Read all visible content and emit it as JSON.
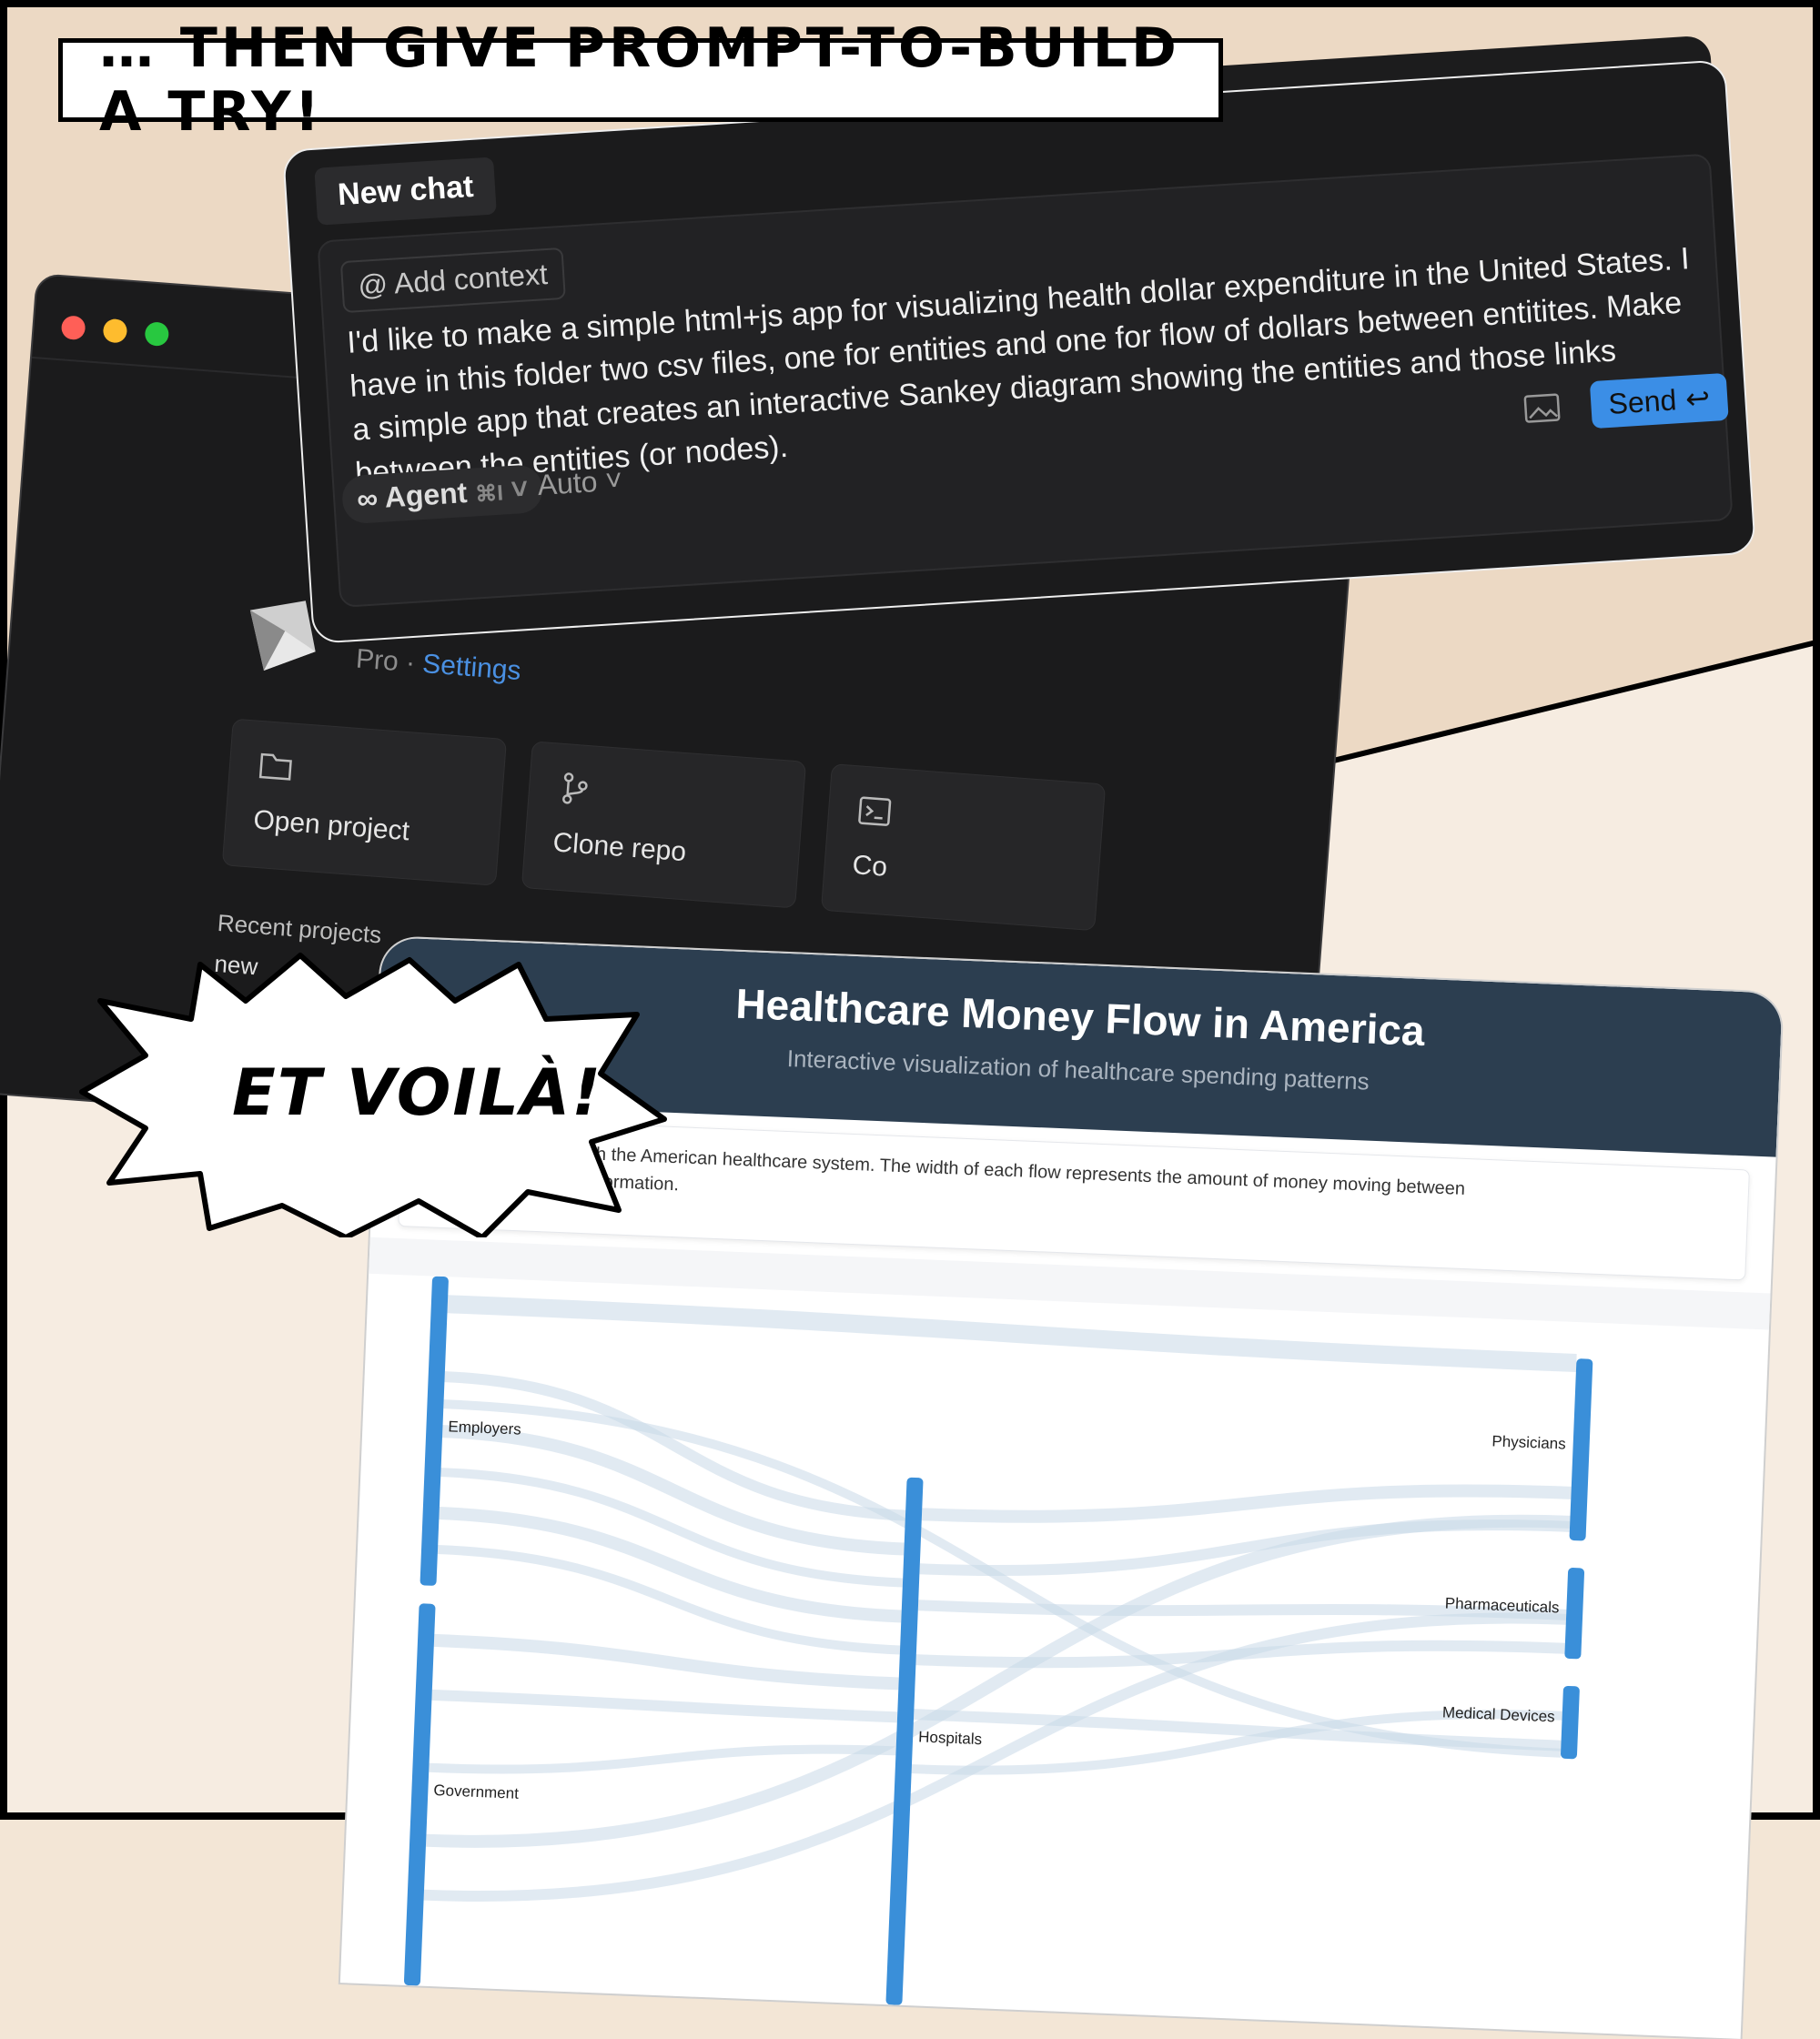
{
  "caption": "… THEN GIVE PROMPT-TO-BUILD A TRY!",
  "burst": "ET VOILÀ!",
  "chat": {
    "tab": "New chat",
    "add_context": "Add context",
    "prompt": "I'd like to make a simple html+js app for visualizing health dollar expenditure in the United States. I have in this folder two csv files, one for entities and one for flow of dollars between entitites. Make a simple app that creates an interactive Sankey diagram showing the entities and those links between the entities (or nodes).",
    "send": "Send",
    "agent": "Agent",
    "agent_shortcut": "⌘I",
    "auto": "Auto"
  },
  "home": {
    "plan": "Pro",
    "settings": "Settings",
    "open_project": "Open project",
    "clone_repo": "Clone repo",
    "third_card": "Co",
    "recent_projects": "Recent projects",
    "recent_item": "new"
  },
  "app": {
    "title": "Healthcare Money Flow in America",
    "subtitle": "Interactive visualization of healthcare spending patterns",
    "info_line1": "w money flows through the American healthcare system. The width of each flow represents the amount of money moving between",
    "info_line2": "lows to see detailed information."
  },
  "chart_data": {
    "type": "sankey",
    "nodes_left": [
      "Employers",
      "Government"
    ],
    "nodes_middle": [
      "Hospitals"
    ],
    "nodes_right": [
      "Physicians",
      "Pharmaceuticals",
      "Medical Devices"
    ],
    "colors": {
      "node": "#3a8fd9",
      "link": "#c9d9e8"
    }
  },
  "colors": {
    "send": "#3b8ee6",
    "app_header": "#2c3e50",
    "traffic_red": "#ff5f57",
    "traffic_yellow": "#febc2e",
    "traffic_green": "#28c840"
  }
}
